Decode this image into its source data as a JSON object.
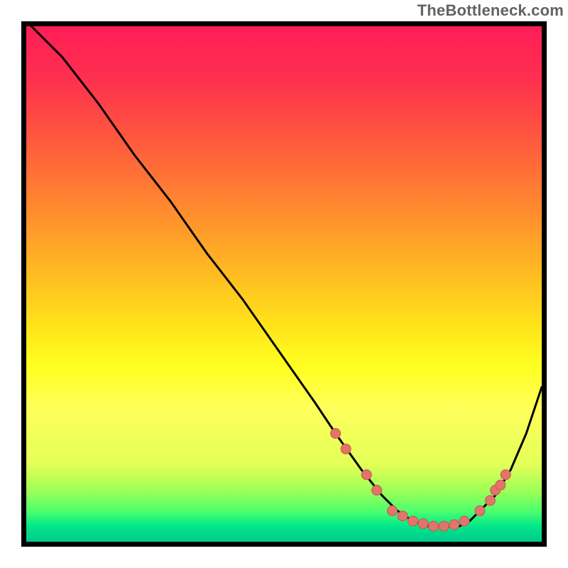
{
  "watermark": "TheBottleneck.com",
  "colors": {
    "curve_stroke": "#000000",
    "point_fill": "#e2746b",
    "point_stroke": "#c7574f"
  },
  "chart_data": {
    "type": "line",
    "title": "",
    "xlabel": "",
    "ylabel": "",
    "ylim": [
      0,
      100
    ],
    "xlim": [
      0,
      100
    ],
    "series": [
      {
        "name": "curve",
        "x": [
          0,
          7,
          14,
          21,
          28,
          35,
          42,
          49,
          56,
          60,
          65,
          69,
          72,
          75,
          78,
          81,
          84,
          86,
          88,
          91,
          94,
          97,
          100
        ],
        "y": [
          101,
          94,
          85,
          75,
          66,
          56,
          47,
          37,
          27,
          21,
          14,
          9,
          6,
          4,
          3,
          3,
          3,
          4,
          6,
          9,
          14,
          21,
          30
        ]
      }
    ],
    "points": [
      {
        "x": 60,
        "y": 21
      },
      {
        "x": 62,
        "y": 18
      },
      {
        "x": 66,
        "y": 13
      },
      {
        "x": 68,
        "y": 10
      },
      {
        "x": 71,
        "y": 6
      },
      {
        "x": 73,
        "y": 5
      },
      {
        "x": 75,
        "y": 4
      },
      {
        "x": 77,
        "y": 3.5
      },
      {
        "x": 79,
        "y": 3
      },
      {
        "x": 81,
        "y": 3
      },
      {
        "x": 83,
        "y": 3.3
      },
      {
        "x": 85,
        "y": 4
      },
      {
        "x": 88,
        "y": 6
      },
      {
        "x": 90,
        "y": 8
      },
      {
        "x": 91,
        "y": 10
      },
      {
        "x": 92,
        "y": 11
      },
      {
        "x": 93,
        "y": 13
      }
    ]
  }
}
